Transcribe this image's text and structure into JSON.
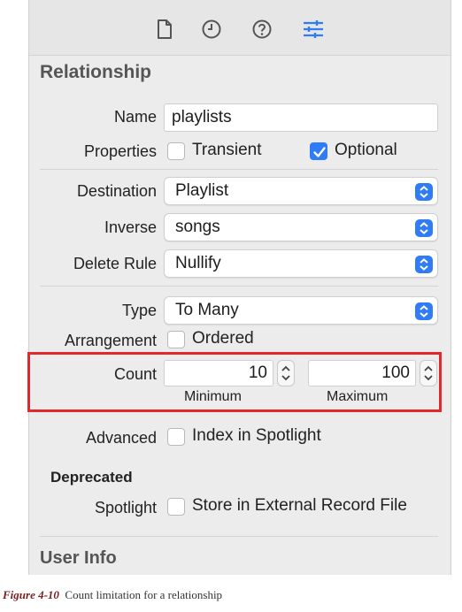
{
  "tabs": [
    {
      "icon": "file-icon"
    },
    {
      "icon": "clock-icon"
    },
    {
      "icon": "help-icon"
    },
    {
      "icon": "sliders-icon"
    }
  ],
  "relationship": {
    "heading": "Relationship",
    "name_label": "Name",
    "name_value": "playlists",
    "properties_label": "Properties",
    "transient_label": "Transient",
    "transient_checked": false,
    "optional_label": "Optional",
    "optional_checked": true,
    "destination_label": "Destination",
    "destination_value": "Playlist",
    "inverse_label": "Inverse",
    "inverse_value": "songs",
    "delete_rule_label": "Delete Rule",
    "delete_rule_value": "Nullify",
    "type_label": "Type",
    "type_value": "To Many",
    "arrangement_label": "Arrangement",
    "ordered_label": "Ordered",
    "ordered_checked": false,
    "count_label": "Count",
    "count_min": "10",
    "count_max": "100",
    "minimum_label": "Minimum",
    "maximum_label": "Maximum",
    "advanced_label": "Advanced",
    "index_spotlight_label": "Index in Spotlight",
    "index_spotlight_checked": false
  },
  "deprecated": {
    "heading": "Deprecated",
    "spotlight_label": "Spotlight",
    "store_external_label": "Store in External Record File",
    "store_external_checked": false
  },
  "user_info": {
    "heading": "User Info"
  },
  "highlight_color": "#e0292f",
  "accent_color": "#2f7cf6",
  "caption": {
    "figure": "Figure 4-10",
    "text": "Count limitation for a relationship"
  }
}
